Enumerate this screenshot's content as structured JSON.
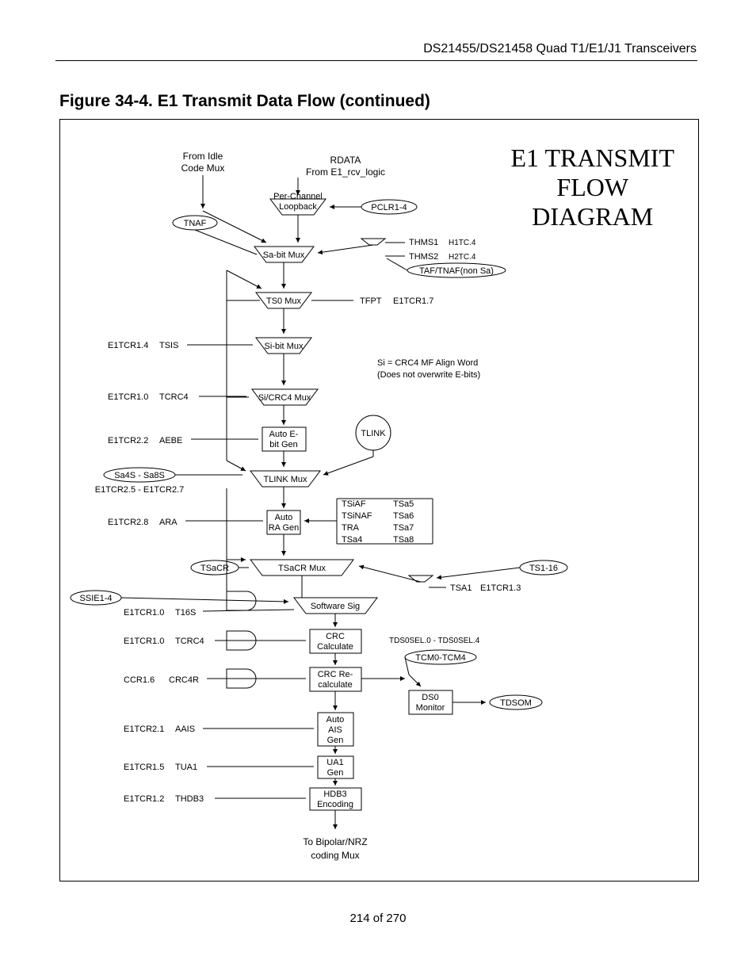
{
  "header": "DS21455/DS21458 Quad T1/E1/J1 Transceivers",
  "figure_title": "Figure 34-4. E1 Transmit Data Flow (continued)",
  "page_number": "214 of 270",
  "big_title_l1": "E1 TRANSMIT",
  "big_title_l2": "FLOW",
  "big_title_l3": "DIAGRAM",
  "top": {
    "from_idle_l1": "From Idle",
    "from_idle_l2": "Code Mux",
    "rdata": "RDATA",
    "from_e1": "From E1_rcv_logic",
    "per_channel_l1": "Per-Channel",
    "per_channel_l2": "Loopback",
    "pclr": "PCLR1-4",
    "tnaf": "TNAF"
  },
  "sabit": {
    "mux": "Sa-bit Mux",
    "thms1": "THMS1",
    "thms1_reg": "H1TC.4",
    "thms2": "THMS2",
    "thms2_reg": "H2TC.4",
    "taf": "TAF/TNAF(non Sa)"
  },
  "ts0": {
    "mux": "TS0 Mux",
    "tfpt": "TFPT",
    "tfpt_reg": "E1TCR1.7"
  },
  "sibit": {
    "label": "E1TCR1.4",
    "name": "TSIS",
    "mux": "Si-bit Mux",
    "note_l1": "Si = CRC4 MF Align Word",
    "note_l2": "(Does not overwrite E-bits)"
  },
  "sicrc4": {
    "label": "E1TCR1.0",
    "name": "TCRC4",
    "mux": "Si/CRC4 Mux"
  },
  "autoe": {
    "label": "E1TCR2.2",
    "name": "AEBE",
    "box_l1": "Auto E-",
    "box_l2": "bit Gen",
    "tlink": "TLINK"
  },
  "tlinkmux": {
    "sa": "Sa4S - Sa8S",
    "reg": "E1TCR2.5 - E1TCR2.7",
    "mux": "TLINK Mux"
  },
  "autora": {
    "label": "E1TCR2.8",
    "name": "ARA",
    "box_l1": "Auto",
    "box_l2": "RA Gen",
    "list": [
      "TSiAF",
      "TSiNAF",
      "TRA",
      "TSa4",
      "TSa5",
      "TSa6",
      "TSa7",
      "TSa8"
    ]
  },
  "tsacr": {
    "tsacr": "TSaCR",
    "mux": "TSaCR Mux",
    "ts116": "TS1-16",
    "tsa1": "TSA1",
    "tsa1_reg": "E1TCR1.3"
  },
  "softsig": {
    "ssie": "SSIE1-4",
    "label": "E1TCR1.0",
    "name": "T16S",
    "box": "Software Sig"
  },
  "crc": {
    "label": "E1TCR1.0",
    "name": "TCRC4",
    "box_l1": "CRC",
    "box_l2": "Calculate",
    "tds": "TDS0SEL.0 - TDS0SEL.4",
    "tcm": "TCM0-TCM4"
  },
  "crcre": {
    "label": "CCR1.6",
    "name": "CRC4R",
    "box_l1": "CRC Re-",
    "box_l2": "calculate"
  },
  "ds0": {
    "box_l1": "DS0",
    "box_l2": "Monitor",
    "tdsom": "TDSOM"
  },
  "autoais": {
    "label": "E1TCR2.1",
    "name": "AAIS",
    "box_l1": "Auto",
    "box_l2": "AIS",
    "box_l3": "Gen"
  },
  "ua1": {
    "label": "E1TCR1.5",
    "name": "TUA1",
    "box_l1": "UA1",
    "box_l2": "Gen"
  },
  "hdb3": {
    "label": "E1TCR1.2",
    "name": "THDB3",
    "box_l1": "HDB3",
    "box_l2": "Encoding"
  },
  "bottom_l1": "To Bipolar/NRZ",
  "bottom_l2": "coding Mux"
}
